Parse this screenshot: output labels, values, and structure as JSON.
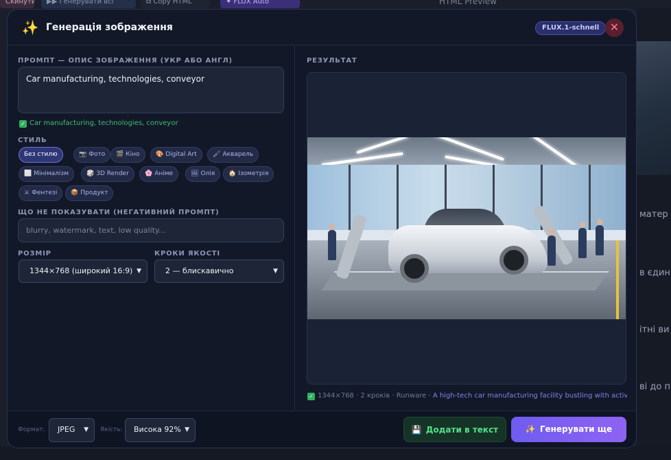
{
  "background": {
    "pills": [
      "Скинути",
      "▶▶ Генерувати всі",
      "⧉ Copy HTML",
      "✦ FLUX Auto"
    ],
    "preview_title": "HTML Preview",
    "right_fragments": [
      "матер",
      "в єдин",
      "ітні ви",
      "ві до п"
    ]
  },
  "modal": {
    "title": "Генерація зображення",
    "model_badge": "FLUX.1-schnell",
    "close_symbol": "✕",
    "colors": {
      "accent": "#7a66f2",
      "success": "#3dbf73",
      "danger": "#ff7a8a"
    }
  },
  "prompt": {
    "label": "ПРОМПТ — ОПИС ЗОБРАЖЕННЯ (УКР АБО АНГЛ)",
    "value": "Car manufacturing, technologies, conveyor",
    "check_text": "Car manufacturing, technologies, conveyor"
  },
  "style": {
    "label": "СТИЛЬ",
    "chips": [
      {
        "label": "Без стилю",
        "icon": "",
        "active": true
      },
      {
        "label": "Фото",
        "icon": "📷",
        "active": false
      },
      {
        "label": "Кіно",
        "icon": "🎬",
        "active": false
      },
      {
        "label": "Digital Art",
        "icon": "🎨",
        "active": false
      },
      {
        "label": "Акварель",
        "icon": "🖌",
        "active": false
      },
      {
        "label": "Мінімалізм",
        "icon": "⬜",
        "active": false
      },
      {
        "label": "3D Render",
        "icon": "🎲",
        "active": false
      },
      {
        "label": "Аніме",
        "icon": "🌸",
        "active": false
      },
      {
        "label": "Олія",
        "icon": "🖼",
        "active": false
      },
      {
        "label": "Ізометрія",
        "icon": "🏠",
        "active": false
      },
      {
        "label": "Фентезі",
        "icon": "⚔",
        "active": false
      },
      {
        "label": "Продукт",
        "icon": "📦",
        "active": false
      }
    ]
  },
  "negative": {
    "label": "ЩО НЕ ПОКАЗУВАТИ (НЕГАТИВНИЙ ПРОМПТ)",
    "placeholder": "blurry, watermark, text, low quality..."
  },
  "size": {
    "label": "РОЗМІР",
    "value": "1344×768 (широкий 16:9)"
  },
  "steps": {
    "label": "КРОКИ ЯКОСТІ",
    "value": "2 — блискавично"
  },
  "result": {
    "label": "РЕЗУЛЬТАТ",
    "meta": "1344×768 · 2 кроків · Runware · ",
    "description": "A high-tech car manufacturing facility bustling with activit..."
  },
  "footer": {
    "format_label": "Формат:",
    "format_value": "JPEG",
    "quality_label": "Якість:",
    "quality_value": "Висока 92%",
    "add_label": "Додати в текст",
    "generate_label": "Генерувати ще"
  }
}
